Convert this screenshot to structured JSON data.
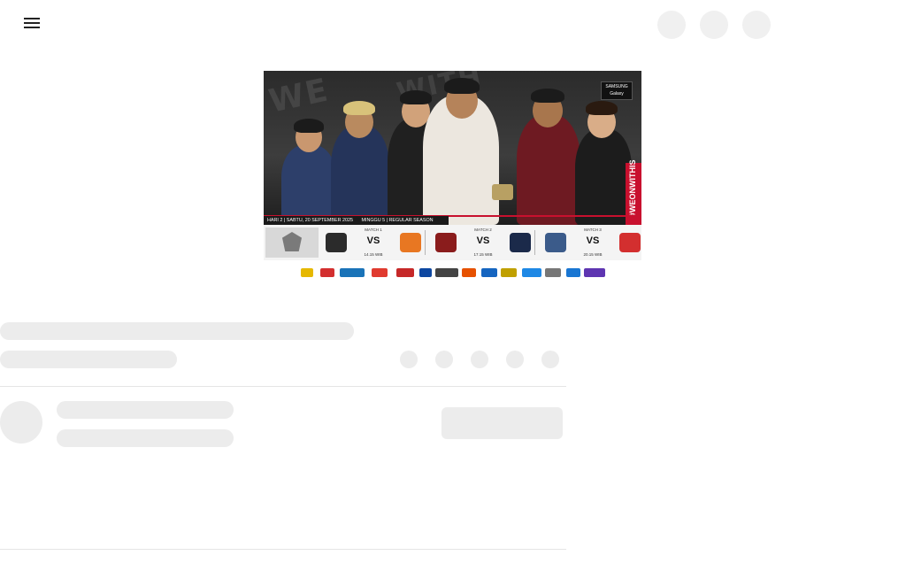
{
  "header": {
    "menu_icon": "hamburger-menu-icon",
    "actions": [
      "search-icon",
      "notification-icon",
      "account-icon"
    ]
  },
  "thumbnail": {
    "hashtag": "#WEONWITHIS",
    "sponsor_tag": "SAMSUNG Galaxy",
    "date_text": "HARI 2 | SABTU, 20 SEPTEMBER 2025",
    "week_text": "MINGGU 5 | REGULAR SEASON",
    "matches": [
      {
        "label": "MATCH 1",
        "vs": "VS",
        "time": "14.15 WIB",
        "home_color": "#2b2b2b",
        "away_color": "#e87722"
      },
      {
        "label": "MATCH 2",
        "vs": "VS",
        "time": "17.15 WIB",
        "home_color": "#8a1c1c",
        "away_color": "#1b2a4a"
      },
      {
        "label": "MATCH 3",
        "vs": "VS",
        "time": "20.15 WIB",
        "home_color": "#3b5b8a",
        "away_color": "#d32f2f"
      }
    ],
    "sponsors": [
      "GoPay",
      "Simpati",
      "Good Day",
      "GamesMax",
      "Oreo",
      "Pocari",
      "Indomie",
      "Maxim"
    ]
  },
  "colors": {
    "skeleton": "#ececec",
    "divider": "#e5e5e5",
    "accent_red": "#c8102e"
  }
}
